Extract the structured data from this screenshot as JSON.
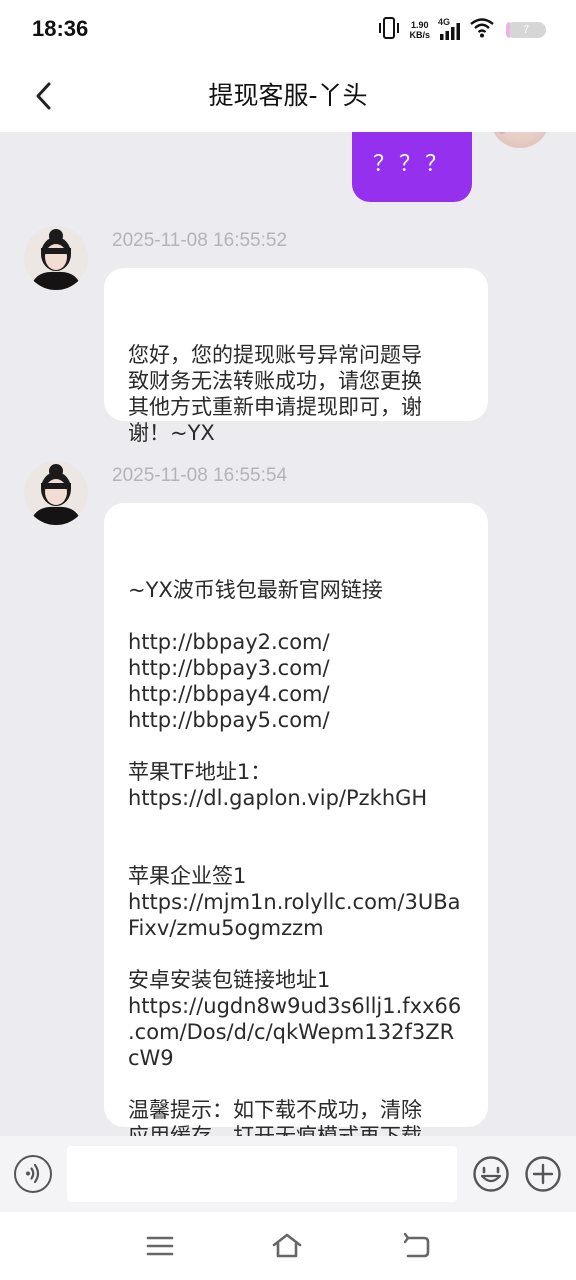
{
  "status_bar": {
    "time": "18:36",
    "net_speed_value": "1.90",
    "net_speed_unit": "KB/s",
    "network_type": "4G",
    "battery_level": "7",
    "battery_fraction": 0.07,
    "icons": [
      "vibrate-icon",
      "signal-icon",
      "wifi-icon",
      "battery-icon"
    ]
  },
  "header": {
    "title": "提现客服-丫头",
    "back_icon": "chevron-left-icon"
  },
  "colors": {
    "accent_purple": "#9430ee",
    "chat_background": "#ececf0",
    "bubble_incoming": "#ffffff",
    "timestamp_gray": "#b4b4b8"
  },
  "messages": {
    "outgoing_1": {
      "text": "？？？"
    },
    "incoming_1": {
      "timestamp": "2025-11-08 16:55:52",
      "lines": [
        "您好，您的提现账号异常问题导",
        "致财务无法转账成功，请您更换",
        "其他方式重新申请提现即可，谢",
        "谢！~YX"
      ]
    },
    "incoming_2": {
      "timestamp": "2025-11-08 16:55:54",
      "lines": [
        "~YX波币钱包最新官网链接",
        "",
        "http://bbpay2.com/",
        "http://bbpay3.com/",
        "http://bbpay4.com/",
        "http://bbpay5.com/",
        "",
        "苹果TF地址1：",
        "https://dl.gaplon.vip/PzkhGH",
        "",
        "",
        "苹果企业签1",
        "https://mjm1n.rolyllc.com/3UBa",
        "Fixv/zmu5ogmzzm",
        "",
        "安卓安装包链接地址1",
        "https://ugdn8w9ud3s6llj1.fxx66",
        ".com/Dos/d/c/qkWepm132f3ZR",
        "cW9",
        "",
        "温馨提示：如下载不成功，清除",
        "应用缓存，打开无痕模式再下载"
      ]
    }
  },
  "input_bar": {
    "placeholder": "",
    "icons": [
      "voice-icon",
      "emoji-icon",
      "plus-icon"
    ]
  },
  "nav_bar": {
    "icons": [
      "menu-icon",
      "home-icon",
      "back-icon"
    ]
  }
}
